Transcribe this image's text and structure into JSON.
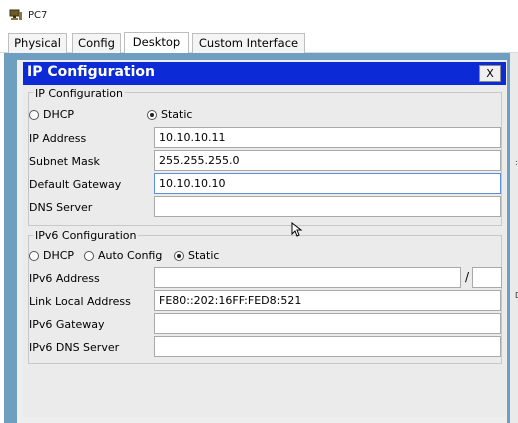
{
  "window": {
    "title": "PC7",
    "icon": "pc-icon"
  },
  "tabs": [
    {
      "label": "Physical"
    },
    {
      "label": "Config"
    },
    {
      "label": "Desktop"
    },
    {
      "label": "Custom Interface"
    }
  ],
  "dialog": {
    "title": "IP Configuration",
    "close_label": "X",
    "ipv4": {
      "group_label": "IP Configuration",
      "dhcp_label": "DHCP",
      "static_label": "Static",
      "mode": "Static",
      "ip_label": "IP Address",
      "ip_value": "10.10.10.11",
      "mask_label": "Subnet Mask",
      "mask_value": "255.255.255.0",
      "gateway_label": "Default Gateway",
      "gateway_value": "10.10.10.10",
      "dns_label": "DNS Server",
      "dns_value": ""
    },
    "ipv6": {
      "group_label": "IPv6 Configuration",
      "dhcp_label": "DHCP",
      "auto_label": "Auto Config",
      "static_label": "Static",
      "mode": "Static",
      "address_label": "IPv6 Address",
      "address_value": "",
      "slash": "/",
      "prefix_value": "",
      "link_local_label": "Link Local Address",
      "link_local_value": "FE80::202:16FF:FED8:521",
      "gateway_label": "IPv6 Gateway",
      "gateway_value": "",
      "dns_label": "IPv6 DNS Server",
      "dns_value": ""
    }
  },
  "side_marks": [
    ":",
    "D"
  ],
  "colors": {
    "dialog_title_bg": "#0c2ad6",
    "desktop_bg": "#6e9ec0"
  }
}
